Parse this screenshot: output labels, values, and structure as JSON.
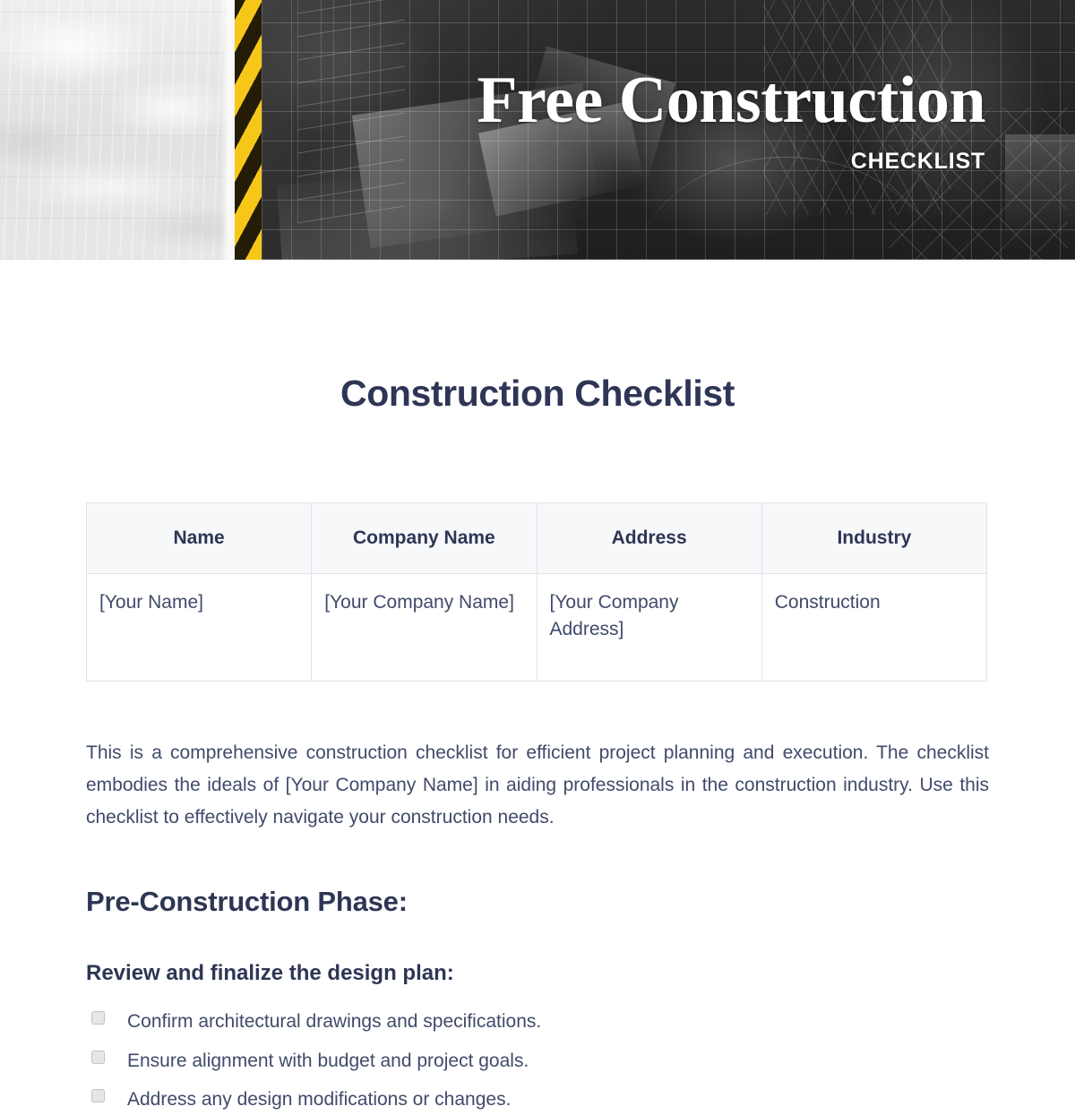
{
  "banner": {
    "title": "Free Construction",
    "subtitle": "CHECKLIST"
  },
  "document": {
    "page_title": "Construction Checklist",
    "intro": "This is a comprehensive construction checklist for efficient project planning and execution. The checklist embodies the ideals of [Your Company Name] in aiding professionals in the construction industry. Use this checklist to effectively navigate your construction needs."
  },
  "info_table": {
    "headers": [
      "Name",
      "Company Name",
      "Address",
      "Industry"
    ],
    "rows": [
      [
        "[Your Name]",
        "[Your Company Name]",
        "[Your Company Address]",
        "Construction"
      ]
    ]
  },
  "sections": [
    {
      "heading": "Pre-Construction Phase:",
      "subsections": [
        {
          "heading": "Review and finalize the design plan:",
          "items": [
            "Confirm architectural drawings and specifications.",
            "Ensure alignment with budget and project goals.",
            "Address any design modifications or changes."
          ]
        }
      ]
    }
  ],
  "colors": {
    "heading_navy": "#2e3655",
    "body_navy": "#414a6b",
    "table_header_bg": "#f7f8fa",
    "table_border": "#e0e3e9",
    "hazard_yellow": "#f6c718",
    "hazard_black": "#241c07",
    "checkbox_fill": "#e6e6e6"
  }
}
